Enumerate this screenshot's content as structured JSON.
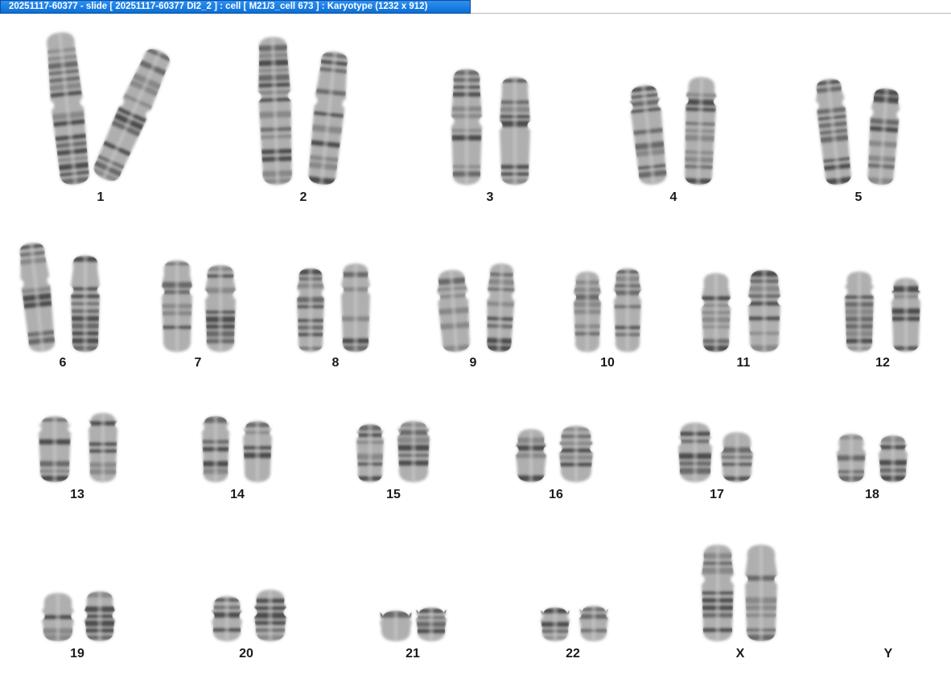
{
  "window": {
    "title": "20251117-60377 - slide [ 20251117-60377 DI2_2 ] : cell [ M21/3_cell 673 ] : Karyotype  (1232 x 912)"
  },
  "karyotype": {
    "chromosomes": [
      {
        "id": "chr1",
        "label": "1"
      },
      {
        "id": "chr2",
        "label": "2"
      },
      {
        "id": "chr3",
        "label": "3"
      },
      {
        "id": "chr4",
        "label": "4"
      },
      {
        "id": "chr5",
        "label": "5"
      },
      {
        "id": "chr6",
        "label": "6"
      },
      {
        "id": "chr7",
        "label": "7"
      },
      {
        "id": "chr8",
        "label": "8"
      },
      {
        "id": "chr9",
        "label": "9"
      },
      {
        "id": "chr10",
        "label": "10"
      },
      {
        "id": "chr11",
        "label": "11"
      },
      {
        "id": "chr12",
        "label": "12"
      },
      {
        "id": "chr13",
        "label": "13"
      },
      {
        "id": "chr14",
        "label": "14"
      },
      {
        "id": "chr15",
        "label": "15"
      },
      {
        "id": "chr16",
        "label": "16"
      },
      {
        "id": "chr17",
        "label": "17"
      },
      {
        "id": "chr18",
        "label": "18"
      },
      {
        "id": "chr19",
        "label": "19"
      },
      {
        "id": "chr20",
        "label": "20"
      },
      {
        "id": "chr21",
        "label": "21"
      },
      {
        "id": "chr22",
        "label": "22"
      },
      {
        "id": "chrX",
        "label": "X"
      },
      {
        "id": "chrY",
        "label": "Y"
      }
    ]
  }
}
